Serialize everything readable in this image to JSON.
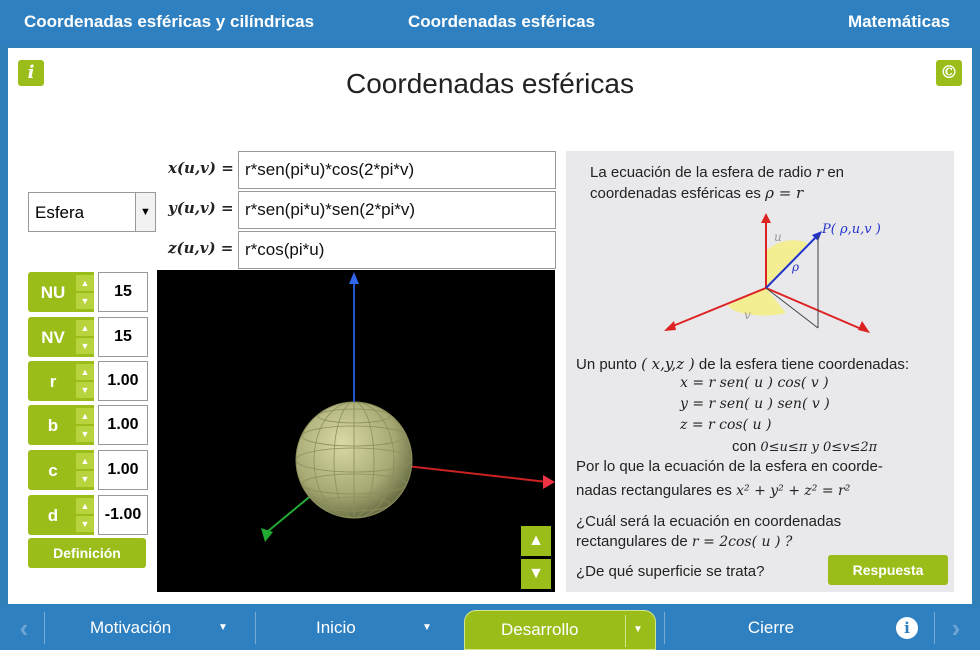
{
  "header": {
    "left": "Coordenadas esféricas y cilíndricas",
    "center": "Coordenadas esféricas",
    "right": "Matemáticas"
  },
  "icons": {
    "info": "i",
    "copyright": "©",
    "info_nav": "i"
  },
  "title": "Coordenadas esféricas",
  "formulas": [
    {
      "label": "x(u,v) =",
      "value": "r*sen(pi*u)*cos(2*pi*v)"
    },
    {
      "label": "y(u,v) =",
      "value": "r*sen(pi*u)*sen(2*pi*v)"
    },
    {
      "label": "z(u,v) =",
      "value": "r*cos(pi*u)"
    }
  ],
  "surface_select": "Esfera",
  "params": [
    {
      "label": "NU",
      "value": "15"
    },
    {
      "label": "NV",
      "value": "15"
    },
    {
      "label": "r",
      "value": "1.00"
    },
    {
      "label": "b",
      "value": "1.00"
    },
    {
      "label": "c",
      "value": "1.00"
    },
    {
      "label": "d",
      "value": "-1.00"
    }
  ],
  "definition_button": "Definición",
  "explanation": {
    "line1a": "La ecuación de la esfera de radio",
    "line1b": "r",
    "line1c": "en",
    "line2a": "coordenadas esféricas es",
    "line2b": "ρ = r",
    "diagram_label_P": "P( ρ,u,v )",
    "diagram_u": "u",
    "diagram_rho": "ρ",
    "diagram_v": "v",
    "point_text_a": "Un punto",
    "point_text_b": "( x,y,z )",
    "point_text_c": "de la esfera tiene coordenadas:",
    "eq_x": "x = r sen( u ) cos( v )",
    "eq_y": "y = r sen( u ) sen( v )",
    "eq_z": "z = r cos( u )",
    "con": "con",
    "range": "0≤u≤π  y  0≤v≤2π",
    "rect1": "Por lo que la ecuación de la esfera en coorde-",
    "rect2a": "nadas rectangulares es",
    "rect2b": "x² + y² + z² = r²",
    "q1": "¿Cuál será la ecuación en coordenadas",
    "q2a": "rectangulares de",
    "q2b": "r = 2cos( u ) ?",
    "q3": "¿De qué superficie se trata?",
    "answer_button": "Respuesta"
  },
  "nav": {
    "motivacion": "Motivación",
    "inicio": "Inicio",
    "desarrollo": "Desarrollo",
    "cierre": "Cierre"
  },
  "colors": {
    "accent_green": "#9bbd1a",
    "bar_blue": "#2f80c0"
  }
}
